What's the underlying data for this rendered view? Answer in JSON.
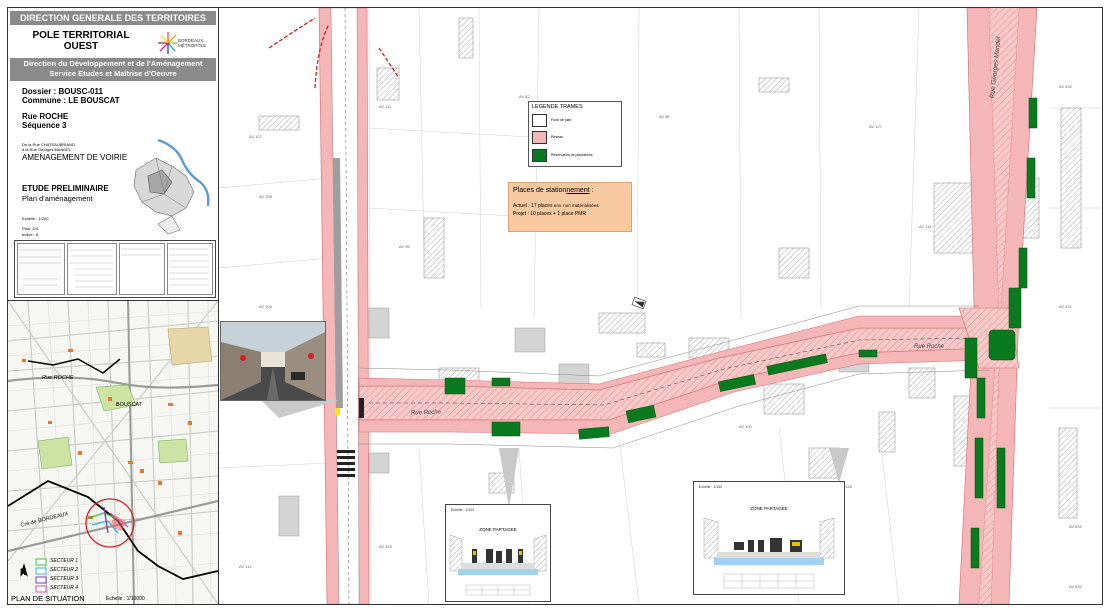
{
  "cartouche": {
    "header": "DIRECTION GENERALE DES TERRITOIRES",
    "pole_line1": "POLE TERRITORIAL",
    "pole_line2": "OUEST",
    "logo_line1": "BORDEAUX",
    "logo_line2": "MÉTROPOLE",
    "direction_line1": "Direction du Développement et de l'Aménagement",
    "direction_line2": "Service Etudes et Maîtrise d'Oeuvre",
    "dossier": "Dossier : BOUSC-011",
    "commune": "Commune : LE BOUSCAT",
    "rue": "Rue ROCHE",
    "sequence": "Séquence 3",
    "from_line1": "De la Rue CHATEAUBRIAND",
    "from_line2": "à la Rue Georges MANDEL",
    "amenagement": "AMENAGEMENT DE VOIRIE",
    "etude": "ETUDE PRELIMINAIRE",
    "plan": "Plan d'aménagement",
    "echelle": "Echelle : 1/200",
    "plan_no": "Plan: 3/4",
    "indice": "Indice : A"
  },
  "location_map": {
    "title": "PLAN DE SITUATION",
    "echelle": "Echelle : 1/10000",
    "north": "N",
    "street_labels": [
      "Rue ROCHE",
      "BOUSCAT",
      "Cré de BORDEAUX"
    ],
    "sectors": [
      {
        "label": "SECTEUR 1",
        "color": "#3fbf3f"
      },
      {
        "label": "SECTEUR 2",
        "color": "#33b5e5"
      },
      {
        "label": "SECTEUR 3",
        "color": "#7a3fbf"
      },
      {
        "label": "SECTEUR 4",
        "color": "#d64fbf"
      }
    ]
  },
  "plan": {
    "street_labels": [
      "Rue Roche",
      "Rue Roche",
      "Rue Georges Mandel"
    ],
    "legend": {
      "title": "LEGENDE TRAMES",
      "items": [
        {
          "label": "Fond de plan",
          "color": "#ffffff"
        },
        {
          "label": "Réseau",
          "color": "#f4b6b6"
        },
        {
          "label": "Réservation de plantations",
          "color": "#0a7a1e"
        }
      ]
    },
    "parking": {
      "title_a": "Places de station",
      "title_b": "nement",
      "title_c": " :",
      "line1_a": "Actuel : 17 places ",
      "line1_b": "env. non matérialisées",
      "line2": "Projet : 10 places + 1 place PMR"
    },
    "section1": {
      "echelle": "Echelle : 1/100",
      "title": "ZONE PARTAGEE"
    },
    "section2": {
      "echelle": "Echelle : 1/100",
      "title": "ZONE PARTAGEE"
    }
  },
  "colors": {
    "road": "#f4b6b6",
    "hatch": "#e78a8a",
    "green": "#0a7a1e",
    "building": "#bdbdbd",
    "accent_red": "#e02020"
  }
}
